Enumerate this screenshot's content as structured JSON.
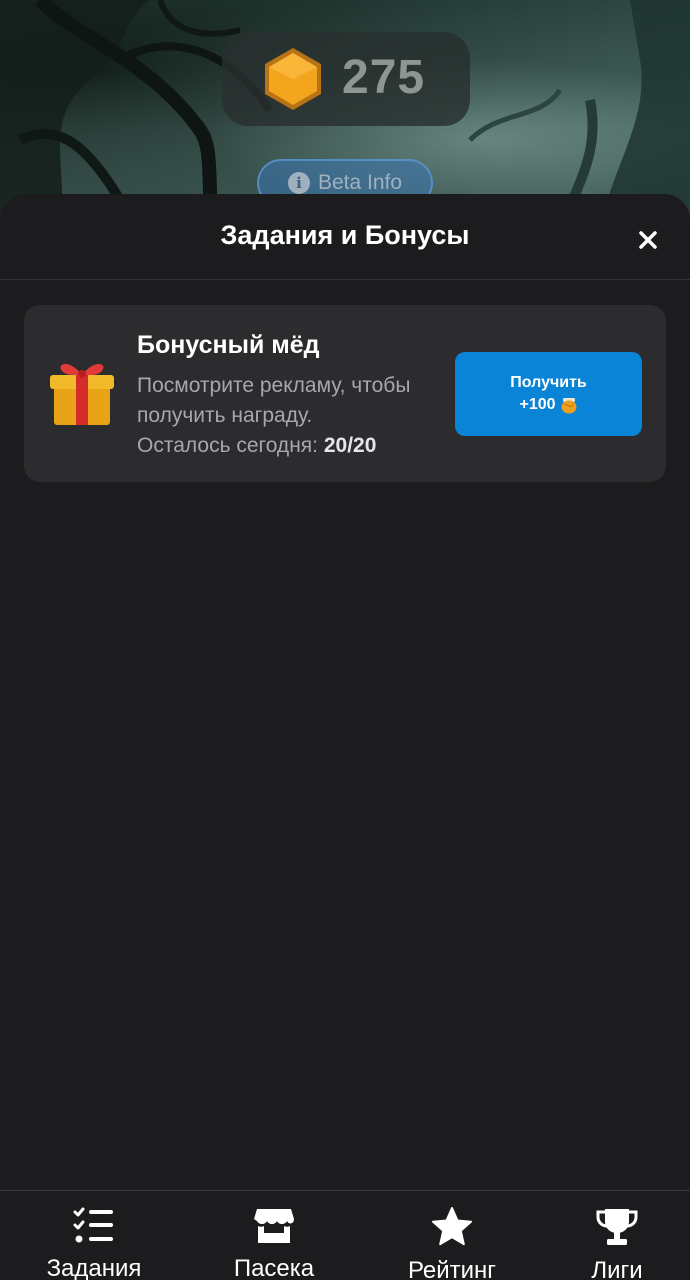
{
  "hud": {
    "honey_count": "275",
    "beta_label": "Beta Info",
    "info_glyph": "i"
  },
  "sheet": {
    "title": "Задания и Бонусы",
    "close_glyph": "×"
  },
  "bonus_card": {
    "title": "Бонусный мёд",
    "description": "Посмотрите рекламу, чтобы получить награду.",
    "remaining_label": "Осталось сегодня:",
    "remaining_value": "20/20",
    "button_line1": "Получить",
    "button_amount": "+100",
    "icon": "gift-icon",
    "button_icon": "honey-pot-icon"
  },
  "nav": {
    "items": [
      {
        "label": "Задания",
        "icon": "checklist-icon"
      },
      {
        "label": "Пасека",
        "icon": "shop-icon"
      },
      {
        "label": "Рейтинг",
        "icon": "star-icon"
      },
      {
        "label": "Лиги",
        "icon": "trophy-icon"
      }
    ]
  },
  "colors": {
    "accent": "#0a84d6",
    "sheet_bg": "#1c1c1e",
    "card_bg": "#2c2c2e",
    "honey": "#f0a020"
  }
}
